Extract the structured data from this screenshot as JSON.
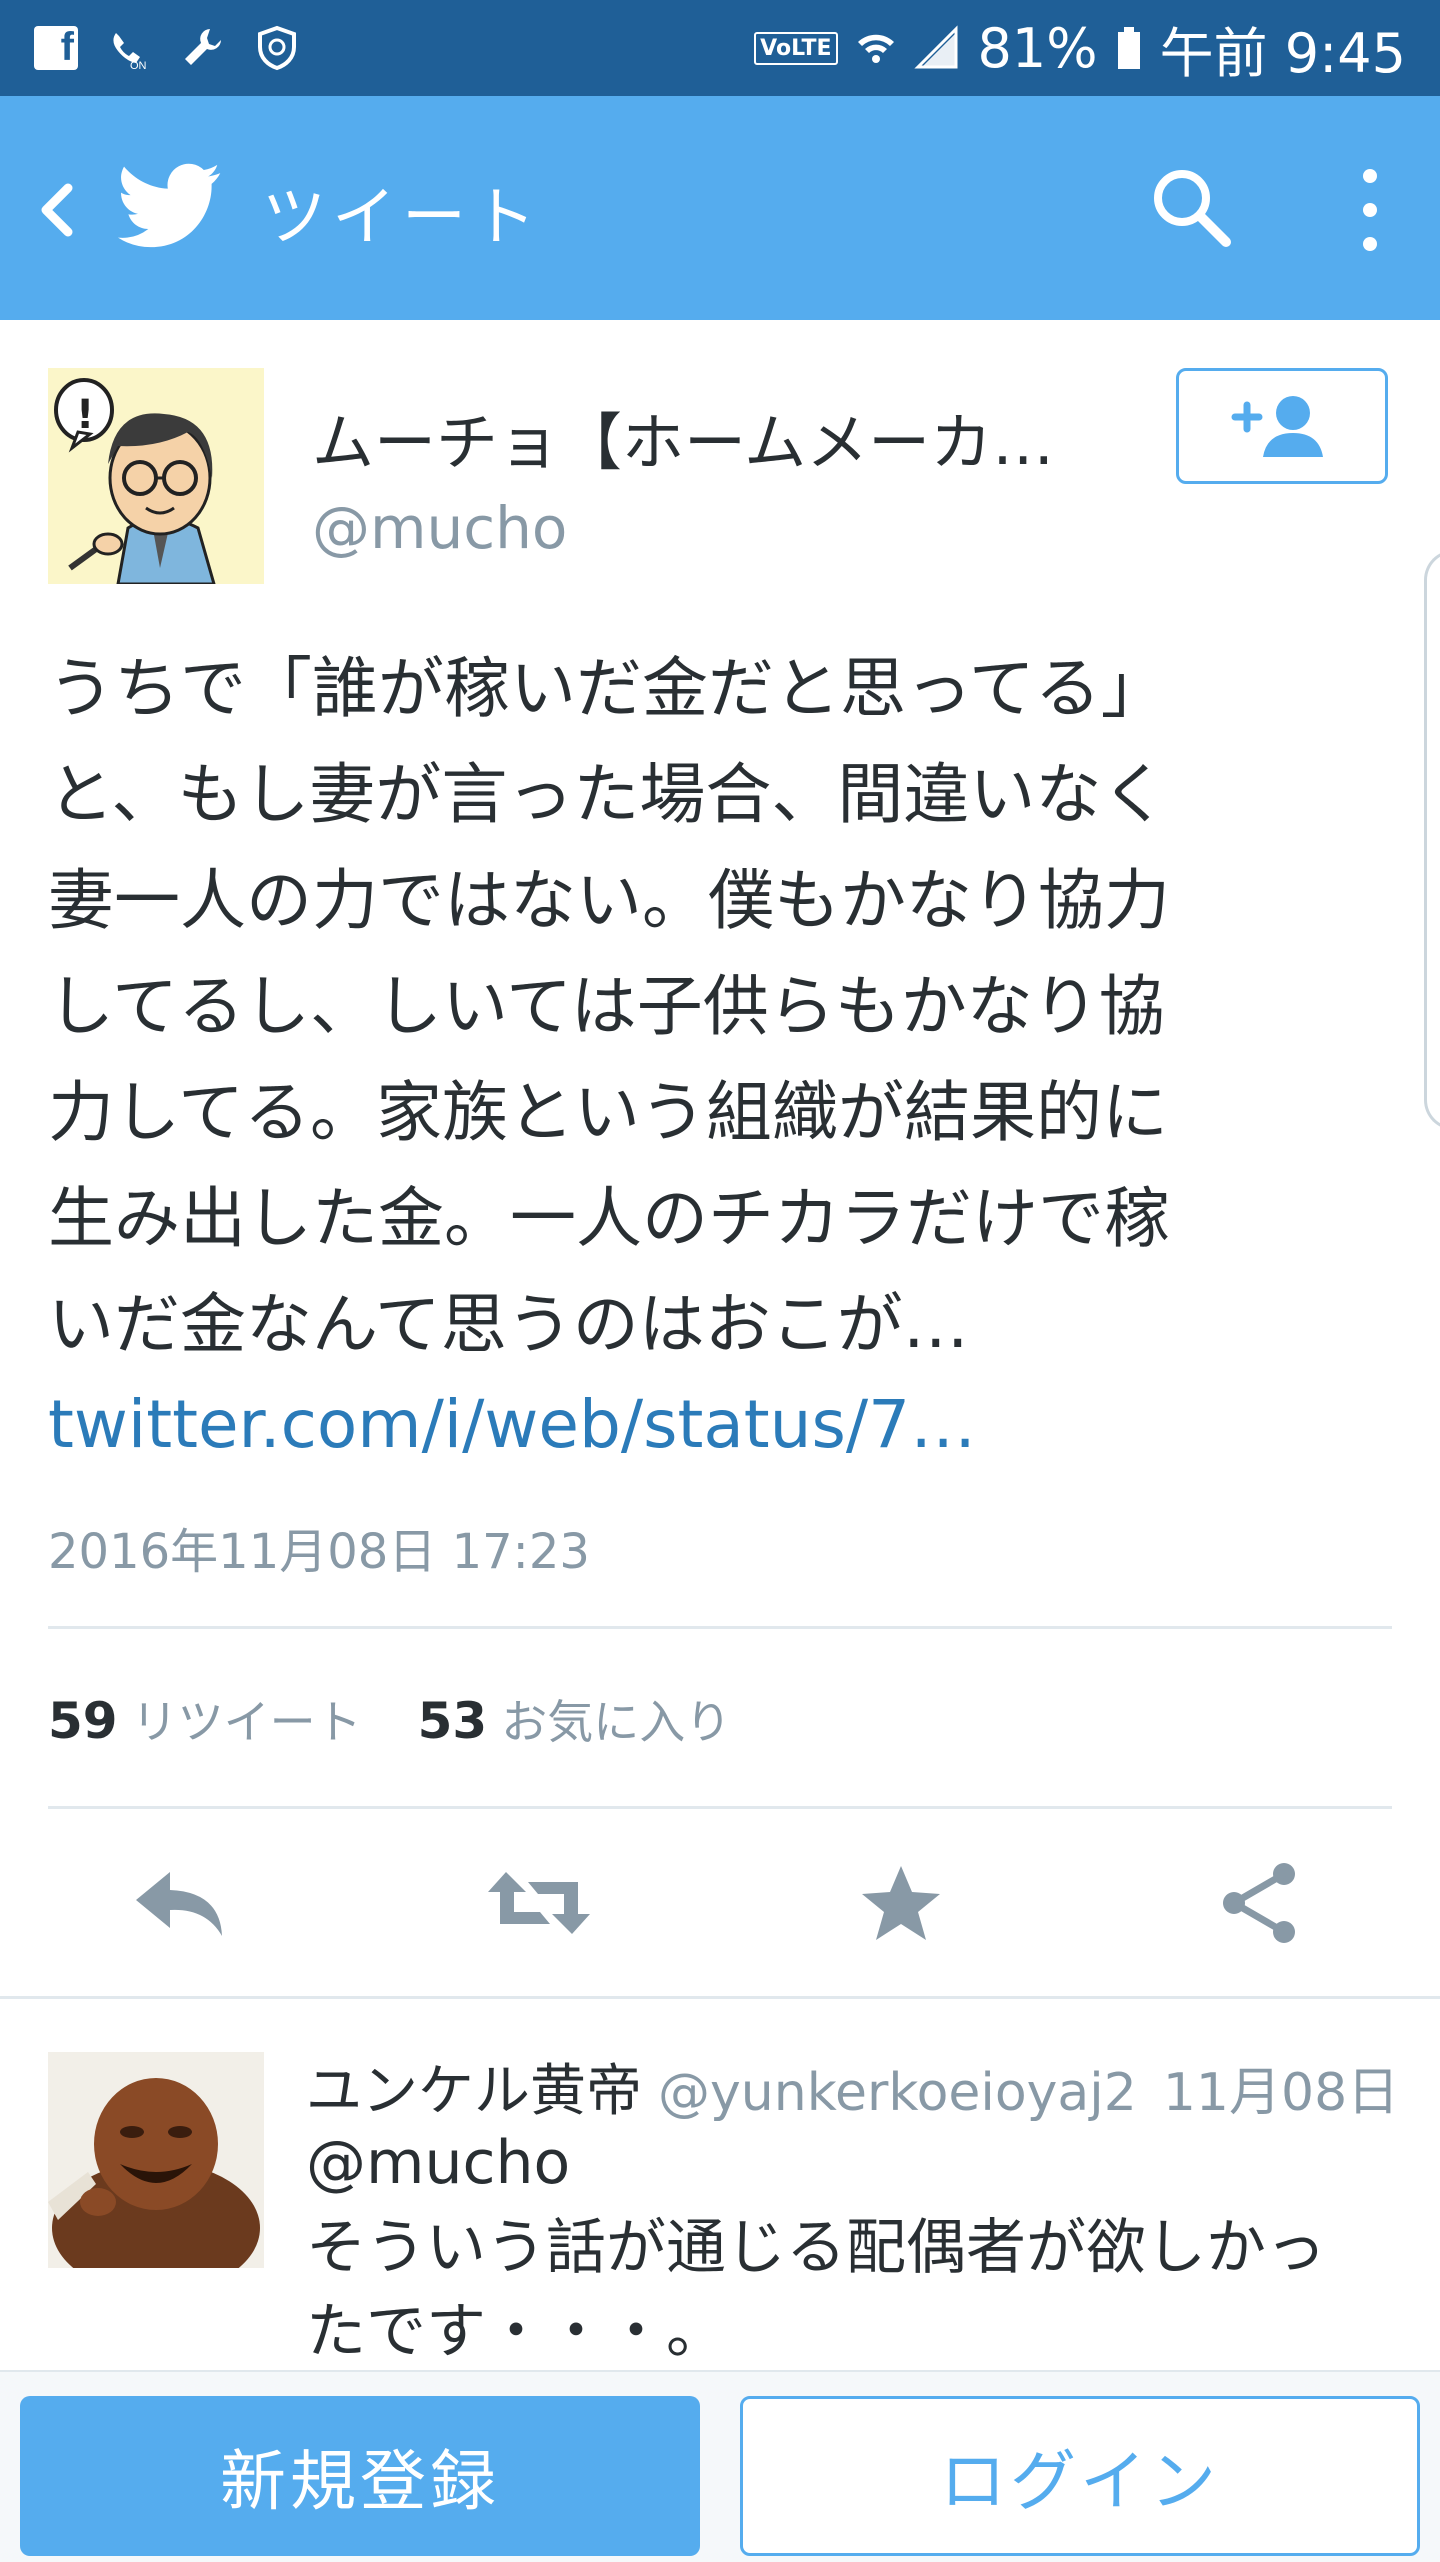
{
  "status_bar": {
    "battery": "81%",
    "time": "午前 9:45",
    "volte": "VoLTE",
    "fb_letter": "f"
  },
  "app_bar": {
    "title": "ツイート"
  },
  "tweet": {
    "author_name": "ムーチョ【ホームメーカ…",
    "author_handle": "@mucho",
    "text": "うちで「誰が稼いだ金だと思ってる」\nと、もし妻が言った場合、間違いなく\n妻一人の力ではない。僕もかなり協力\nしてるし、しいては子供らもかなり協\n力してる。家族という組織が結果的に\n生み出した金。一人のチカラだけで稼\nいだ金なんて思うのはおこが…",
    "link": "twitter.com/i/web/status/7…",
    "timestamp": "2016年11月08日 17:23",
    "retweet_count": "59",
    "retweet_label": "リツイート",
    "favorite_count": "53",
    "favorite_label": "お気に入り"
  },
  "reply": {
    "name": "ユンケル黄帝",
    "handle": "@yunkerkoeioyaj2",
    "date": "11月08日",
    "reply_to": "@mucho",
    "text": "そういう話が通じる配偶者が欲しかったです・・・。"
  },
  "bottom": {
    "signup_label": "新規登録",
    "login_label": "ログイン"
  },
  "colors": {
    "brand": "#55acee",
    "status_bar": "#1f5f97",
    "link": "#2b7bb9",
    "muted": "#8899a6"
  }
}
